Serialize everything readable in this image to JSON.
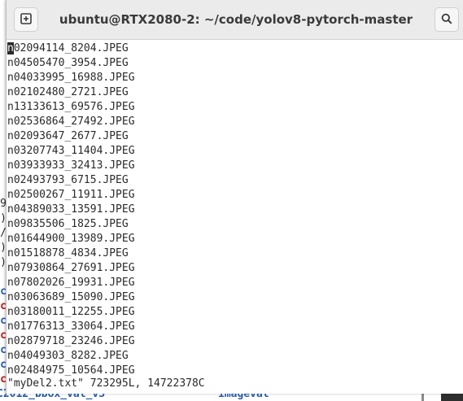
{
  "window": {
    "title": "ubuntu@RTX2080-2: ~/code/yolov8-pytorch-master",
    "new_tab_icon": "new-tab-icon",
    "search_icon": "search-icon"
  },
  "editor": {
    "cursor_char": "n",
    "first_line_rest": "02094114_8204.JPEG",
    "lines": [
      "n04505470_3954.JPEG",
      "n04033995_16988.JPEG",
      "n02102480_2721.JPEG",
      "n13133613_69576.JPEG",
      "n02536864_27492.JPEG",
      "n02093647_2677.JPEG",
      "n03207743_11404.JPEG",
      "n03933933_32413.JPEG",
      "n02493793_6715.JPEG",
      "n02500267_11911.JPEG",
      "n04389033_13591.JPEG",
      "n09835506_1825.JPEG",
      "n01644900_13989.JPEG",
      "n01518878_4834.JPEG",
      "n07930864_27691.JPEG",
      "n07802026_19931.JPEG",
      "n03063689_15090.JPEG",
      "n03180011_12255.JPEG",
      "n01776313_33064.JPEG",
      "n02879718_23246.JPEG",
      "n04049303_8282.JPEG",
      "n02484975_10564.JPEG"
    ],
    "status": "\"myDel2.txt\" 723295L, 14722378C"
  },
  "background_terminal": {
    "left_fragments": [
      "9",
      ")",
      "/",
      ")",
      ")",
      "c",
      "c",
      "c",
      "c",
      "c",
      "c",
      "c",
      "c"
    ],
    "bottom_row_left": "C2012_bbox_val_v3",
    "bottom_row_right": "imageval"
  }
}
